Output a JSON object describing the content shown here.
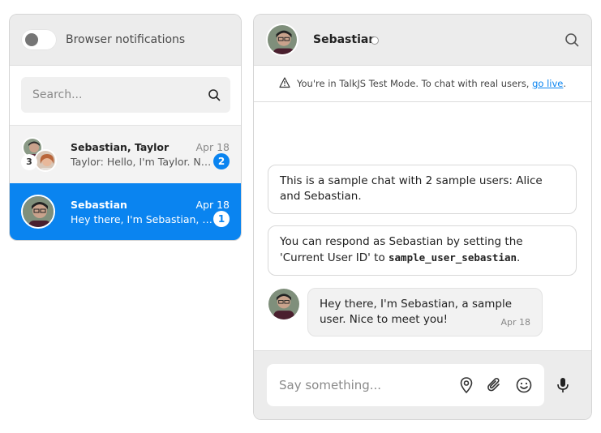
{
  "inbox": {
    "notifications_label": "Browser notifications",
    "search_placeholder": "Search...",
    "conversations": [
      {
        "title": "Sebastian, Taylor",
        "date": "Apr 18",
        "preview": "Taylor: Hello, I'm Taylor. Nice to meet you!",
        "unread": "2",
        "member_count": "3"
      },
      {
        "title": "Sebastian",
        "date": "Apr 18",
        "preview": "Hey there, I'm Sebastian, a sample user. Nice to meet you!",
        "unread": "1"
      }
    ],
    "selected_color": "#0a84f0"
  },
  "chat": {
    "header_name": "Sebastian",
    "testmode_text": "You're in TalkJS Test Mode. To chat with real users,",
    "testmode_link": "go live",
    "testmode_period": ".",
    "system_messages": [
      {
        "text": "This is a sample chat with 2 sample users: Alice and Sebastian."
      },
      {
        "text_before": "You can respond as Sebastian by setting the 'Current User ID' to ",
        "code": "sample_user_sebastian",
        "text_after": "."
      }
    ],
    "message": {
      "text": "Hey there, I'm Sebastian, a sample user. Nice to meet you!",
      "time": "Apr 18"
    },
    "composer_placeholder": "Say something...",
    "icons": [
      "location-icon",
      "attachment-icon",
      "emoji-icon",
      "microphone-icon",
      "search-icon",
      "warning-icon"
    ]
  }
}
